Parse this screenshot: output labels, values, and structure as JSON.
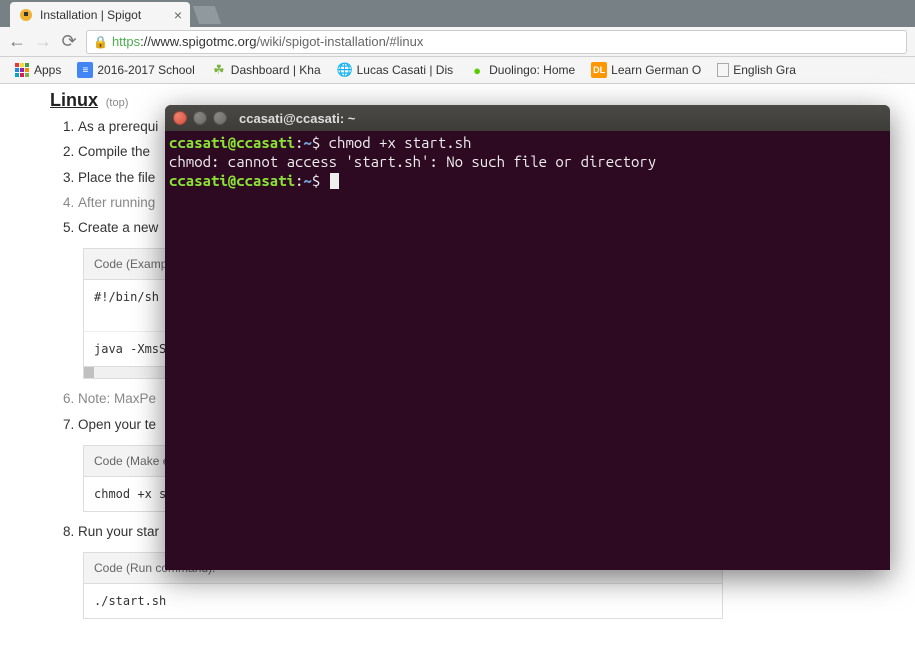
{
  "browser": {
    "tab_title": "Installation | Spigot",
    "url": {
      "https": "https",
      "host": "://www.spigotmc.org",
      "path": "/wiki/spigot-installation/#linux"
    },
    "bookmarks": [
      {
        "label": "Apps",
        "icon": "apps"
      },
      {
        "label": "2016-2017 School",
        "icon": "docs"
      },
      {
        "label": "Dashboard | Kha",
        "icon": "leaf"
      },
      {
        "label": "Lucas Casati | Dis",
        "icon": "globe"
      },
      {
        "label": "Duolingo: Home",
        "icon": "owl"
      },
      {
        "label": "Learn German O",
        "icon": "dl"
      },
      {
        "label": "English Gra",
        "icon": "page"
      }
    ]
  },
  "page": {
    "heading": "Linux",
    "top_label": "(top)",
    "steps": [
      "As a prerequi",
      "Compile the ",
      "Place the file",
      "After running",
      "Create a new"
    ],
    "code_example": {
      "title": "Code (Exampl",
      "line1": "#!/bin/sh",
      "line2": "java -XmsS"
    },
    "step6": "Note: MaxPe",
    "step7": "Open your te",
    "code_exec": {
      "title": "Code (Make ex",
      "line1": "chmod +x s"
    },
    "step8": "Run your star",
    "code_run": {
      "title": "Code (Run command):",
      "line1": "./start.sh"
    }
  },
  "terminal": {
    "title": "ccasati@ccasati: ~",
    "prompt_userhost": "ccasati@ccasati",
    "prompt_sep1": ":",
    "prompt_path": "~",
    "prompt_sep2": "$ ",
    "cmd1": "chmod +x start.sh",
    "out1": "chmod: cannot access 'start.sh': No such file or directory"
  }
}
